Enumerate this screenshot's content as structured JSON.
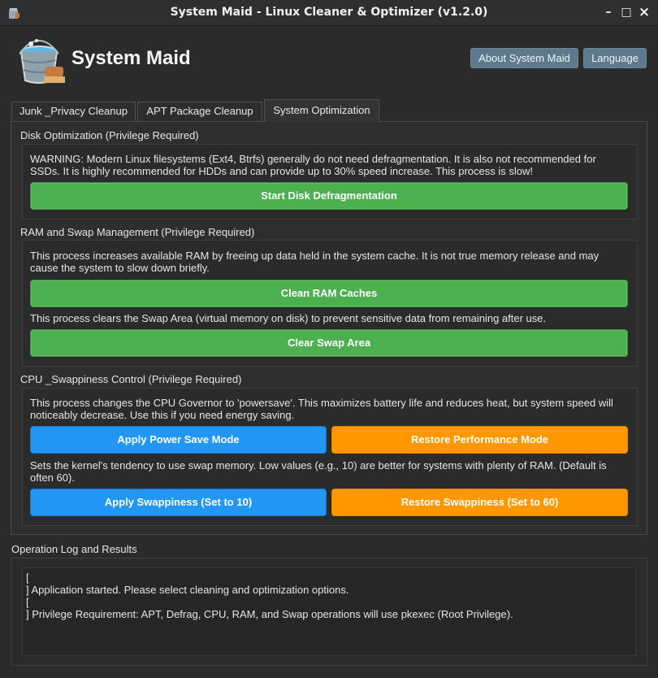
{
  "window": {
    "title": "System Maid - Linux Cleaner & Optimizer (v1.2.0)",
    "minimize_glyph": "–",
    "maximize_glyph": "□",
    "close_glyph": "×"
  },
  "header": {
    "app_name": "System Maid",
    "about_label": "About System Maid",
    "language_label": "Language"
  },
  "tabs": [
    {
      "label": "Junk _Privacy Cleanup",
      "active": false
    },
    {
      "label": "APT Package Cleanup",
      "active": false
    },
    {
      "label": "System Optimization",
      "active": true
    }
  ],
  "sections": {
    "disk": {
      "title": "Disk Optimization (Privilege Required)",
      "warning_line1": "WARNING: Modern Linux filesystems (Ext4, Btrfs) generally do not need defragmentation. It is also not recommended for",
      "warning_line2": "SSDs. It is highly recommended for HDDs and can provide up to 30% speed increase. This process is slow!",
      "defrag_button": "Start Disk Defragmentation"
    },
    "ram": {
      "title": "RAM and Swap Management (Privilege Required)",
      "cache_desc_line1": "This process increases available RAM by freeing up data held in the system cache. It is not true memory release and may",
      "cache_desc_line2": "cause the system to slow down briefly.",
      "clean_ram_button": "Clean RAM Caches",
      "swap_desc": "This process clears the Swap Area (virtual memory on disk) to prevent sensitive data from remaining after use.",
      "clear_swap_button": "Clear Swap Area"
    },
    "cpu": {
      "title": "CPU _Swappiness Control (Privilege Required)",
      "governor_desc_line1": "This process changes the CPU Governor to 'powersave'. This maximizes battery life and reduces heat, but system speed will",
      "governor_desc_line2": "noticeably decrease. Use this if you need energy saving.",
      "power_save_button": "Apply Power Save Mode",
      "performance_button": "Restore Performance Mode",
      "swappiness_desc_line1": "Sets the kernel's tendency to use swap memory. Low values (e.g., 10) are better for systems with plenty of RAM. (Default is",
      "swappiness_desc_line2": "often 60).",
      "apply_swappiness_button": "Apply Swappiness (Set to 10)",
      "restore_swappiness_button": "Restore Swappiness (Set to 60)"
    }
  },
  "log": {
    "title": "Operation Log and Results",
    "lines": [
      "[",
      "] Application started. Please select cleaning and optimization options.",
      "[",
      "] Privilege Requirement: APT, Defrag, CPU, RAM, and Swap operations will use pkexec (Root Privilege)."
    ]
  },
  "colors": {
    "green": "#4caf50",
    "blue": "#2196f3",
    "orange": "#ff9800",
    "header_button": "#5d7a8c"
  }
}
